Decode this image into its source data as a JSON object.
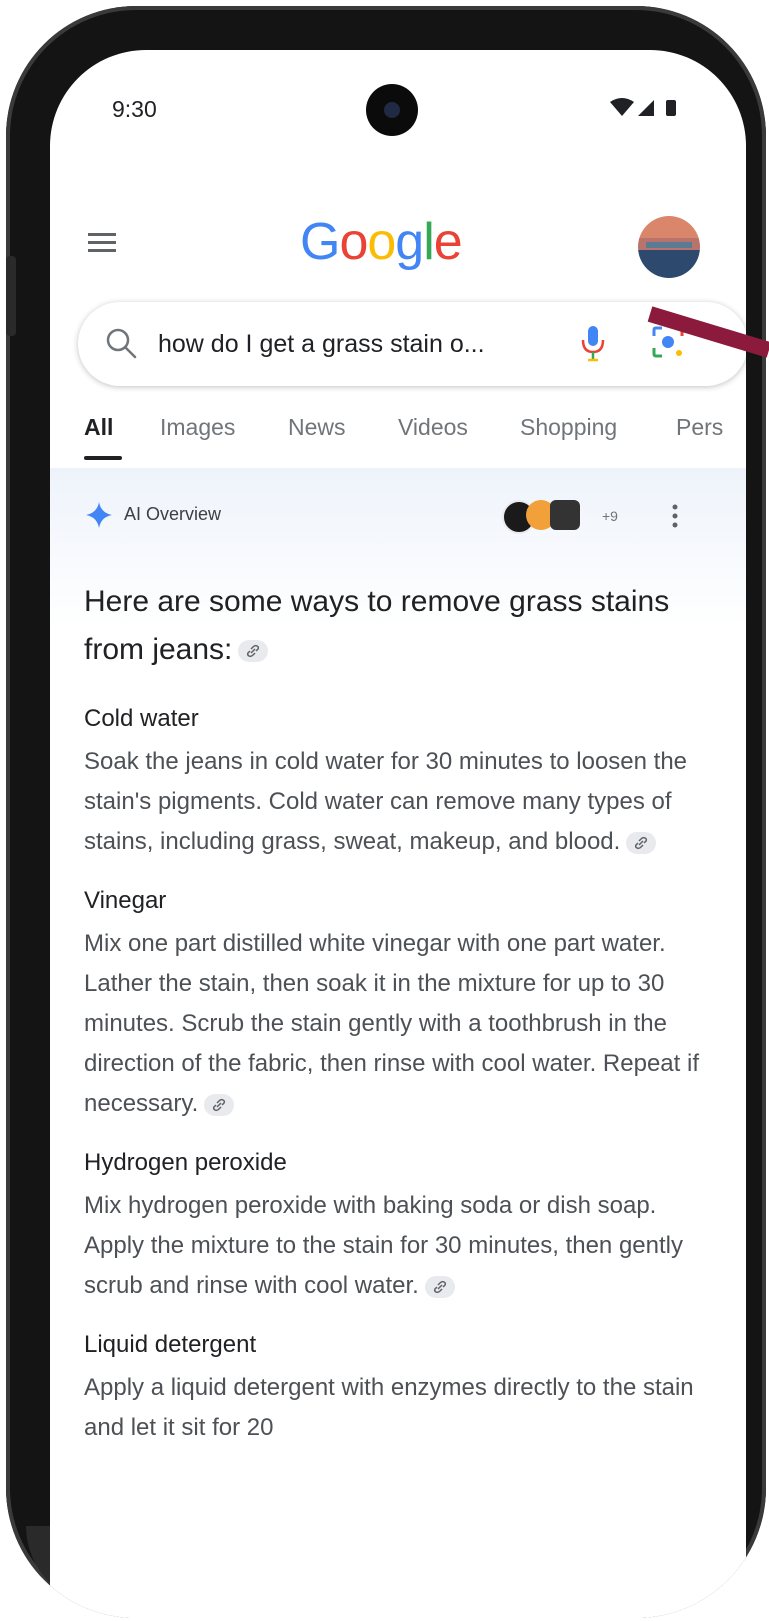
{
  "status_bar": {
    "time": "9:30"
  },
  "header": {
    "logo_letters": [
      {
        "char": "G",
        "color": "#4285F4"
      },
      {
        "char": "o",
        "color": "#EA4335"
      },
      {
        "char": "o",
        "color": "#FBBC05"
      },
      {
        "char": "g",
        "color": "#4285F4"
      },
      {
        "char": "l",
        "color": "#34A853"
      },
      {
        "char": "e",
        "color": "#EA4335"
      }
    ]
  },
  "search": {
    "query": "how do I get a grass stain o..."
  },
  "tabs": [
    {
      "label": "All",
      "active": true
    },
    {
      "label": "Images"
    },
    {
      "label": "News"
    },
    {
      "label": "Videos"
    },
    {
      "label": "Shopping"
    },
    {
      "label": "Pers"
    }
  ],
  "ai_overview": {
    "label": "AI Overview",
    "source_count": "+9",
    "intro": "Here are some ways to remove grass stains from jeans:",
    "sections": [
      {
        "title": "Cold water",
        "body": "Soak the jeans in cold water for 30 minutes to loosen the stain's pigments. Cold water can remove many types of stains, including grass, sweat, makeup, and blood."
      },
      {
        "title": "Vinegar",
        "body": "Mix one part distilled white vinegar with one part water. Lather the stain, then soak it in the mixture for up to 30 minutes. Scrub the stain gently with a toothbrush in the direction of the fabric, then rinse with cool water. Repeat if necessary."
      },
      {
        "title": "Hydrogen peroxide",
        "body": "Mix hydrogen peroxide with baking soda or dish soap. Apply the mixture to the stain for 30 minutes, then gently scrub and rinse with cool water."
      },
      {
        "title": "Liquid detergent",
        "body": "Apply a liquid detergent with enzymes directly to the stain and let it sit for 20"
      }
    ]
  },
  "colors": {
    "accent_arrow": "#8b1a3c",
    "ai_sparkle": "#4285F4",
    "background_tint": "#eef3fb"
  }
}
